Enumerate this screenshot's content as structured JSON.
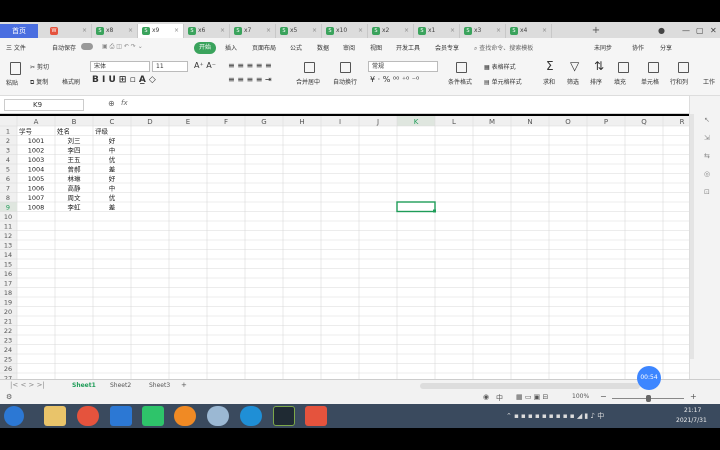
{
  "app": {
    "home_tab": "首页",
    "tabs": [
      {
        "label": "",
        "kind": "red"
      },
      {
        "label": "x8",
        "kind": "green"
      },
      {
        "label": "x9",
        "kind": "green",
        "active": true
      },
      {
        "label": "x6",
        "kind": "green"
      },
      {
        "label": "x7",
        "kind": "green"
      },
      {
        "label": "x5",
        "kind": "green"
      },
      {
        "label": "x10",
        "kind": "green"
      },
      {
        "label": "x2",
        "kind": "green"
      },
      {
        "label": "x1",
        "kind": "green"
      },
      {
        "label": "x3",
        "kind": "green"
      },
      {
        "label": "x4",
        "kind": "green"
      }
    ],
    "add_tab": "+"
  },
  "menubar": {
    "file": "三 文件",
    "autosave": "自动保存",
    "items": [
      "开始",
      "插入",
      "页面布局",
      "公式",
      "数据",
      "审阅",
      "视图",
      "开发工具",
      "会员专享"
    ],
    "search": "查找命令、搜索模板",
    "right": [
      "未同步",
      "协作",
      "分享"
    ]
  },
  "ribbon": {
    "cut": "剪切",
    "copy": "复制",
    "format_painter": "格式刷",
    "paste": "粘贴",
    "font_name": "宋体",
    "font_size": "11",
    "merge": "合并居中",
    "wrap": "自动换行",
    "number_format": "常规",
    "conditional": "条件格式",
    "table_style": "表格样式",
    "cell_style": "单元格样式",
    "sum": "求和",
    "filter": "筛选",
    "sort": "排序",
    "fill": "填充",
    "cells": "单元格",
    "rowcol": "行和列",
    "tools": "工作"
  },
  "formula": {
    "name_box": "K9",
    "fx": "fx",
    "value": ""
  },
  "grid": {
    "columns": [
      "A",
      "B",
      "C",
      "D",
      "E",
      "F",
      "G",
      "H",
      "I",
      "J",
      "K",
      "L",
      "M",
      "N",
      "O",
      "P",
      "Q",
      "R"
    ],
    "selected_col": "K",
    "selected_row": 9,
    "rows": [
      [
        "学号",
        "姓名",
        "评级"
      ],
      [
        "1001",
        "刘三",
        "好"
      ],
      [
        "1002",
        "李四",
        "中"
      ],
      [
        "1003",
        "王五",
        "优"
      ],
      [
        "1004",
        "曾郝",
        "差"
      ],
      [
        "1005",
        "林琳",
        "好"
      ],
      [
        "1006",
        "高静",
        "中"
      ],
      [
        "1007",
        "周文",
        "优"
      ],
      [
        "1008",
        "李虹",
        "差"
      ]
    ],
    "row_count": 27
  },
  "sheets": [
    "Sheet1",
    "Sheet2",
    "Sheet3"
  ],
  "add_sheet": "+",
  "status": {
    "zoom": "100%",
    "lang": "中",
    "time": "21:17",
    "date": "2021/7/31"
  },
  "timer": "00:54",
  "colors": {
    "accent": "#3aa35c",
    "home_tab": "#4a6ee0",
    "selection": "#1e9c58",
    "timer": "#3d86ff"
  }
}
